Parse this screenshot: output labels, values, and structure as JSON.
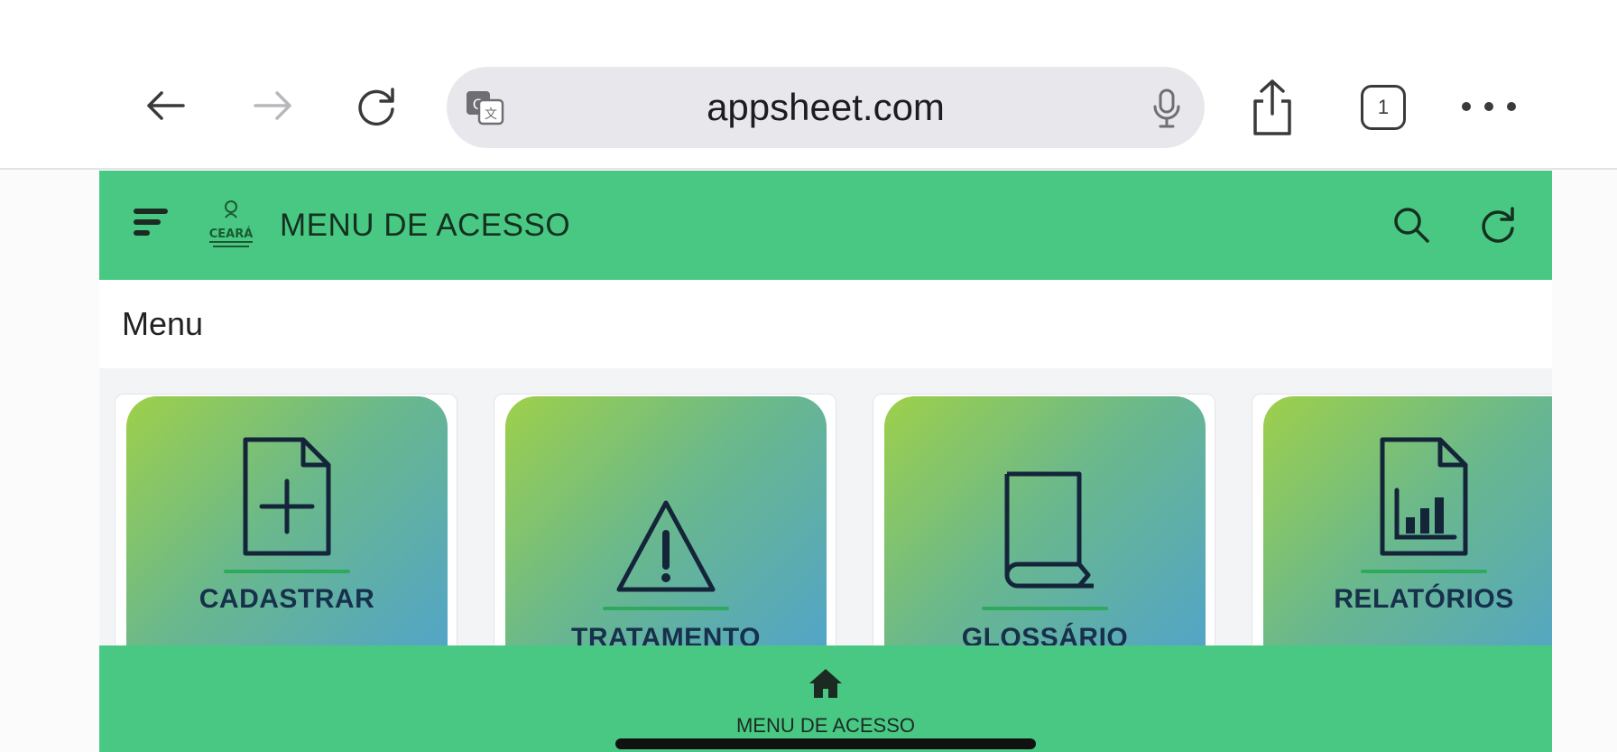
{
  "browser": {
    "url": "appsheet.com",
    "tab_count": "1"
  },
  "app": {
    "header_title": "MENU DE ACESSO",
    "logo_text": "CEARÁ",
    "section_title": "Menu",
    "tiles": [
      {
        "label": "CADASTRAR",
        "icon": "document-plus-icon"
      },
      {
        "label": "TRATAMENTO",
        "icon": "warning-triangle-icon"
      },
      {
        "label": "GLOSSÁRIO",
        "icon": "book-icon"
      },
      {
        "label": "RELATÓRIOS",
        "icon": "report-chart-icon"
      }
    ],
    "bottom_nav": {
      "label": "MENU DE ACESSO",
      "icon": "home-icon"
    }
  },
  "colors": {
    "header_green": "#49c884",
    "tile_gradient_start": "#9ed04a",
    "tile_gradient_end": "#4fa2cf",
    "label_navy": "#17304b"
  }
}
